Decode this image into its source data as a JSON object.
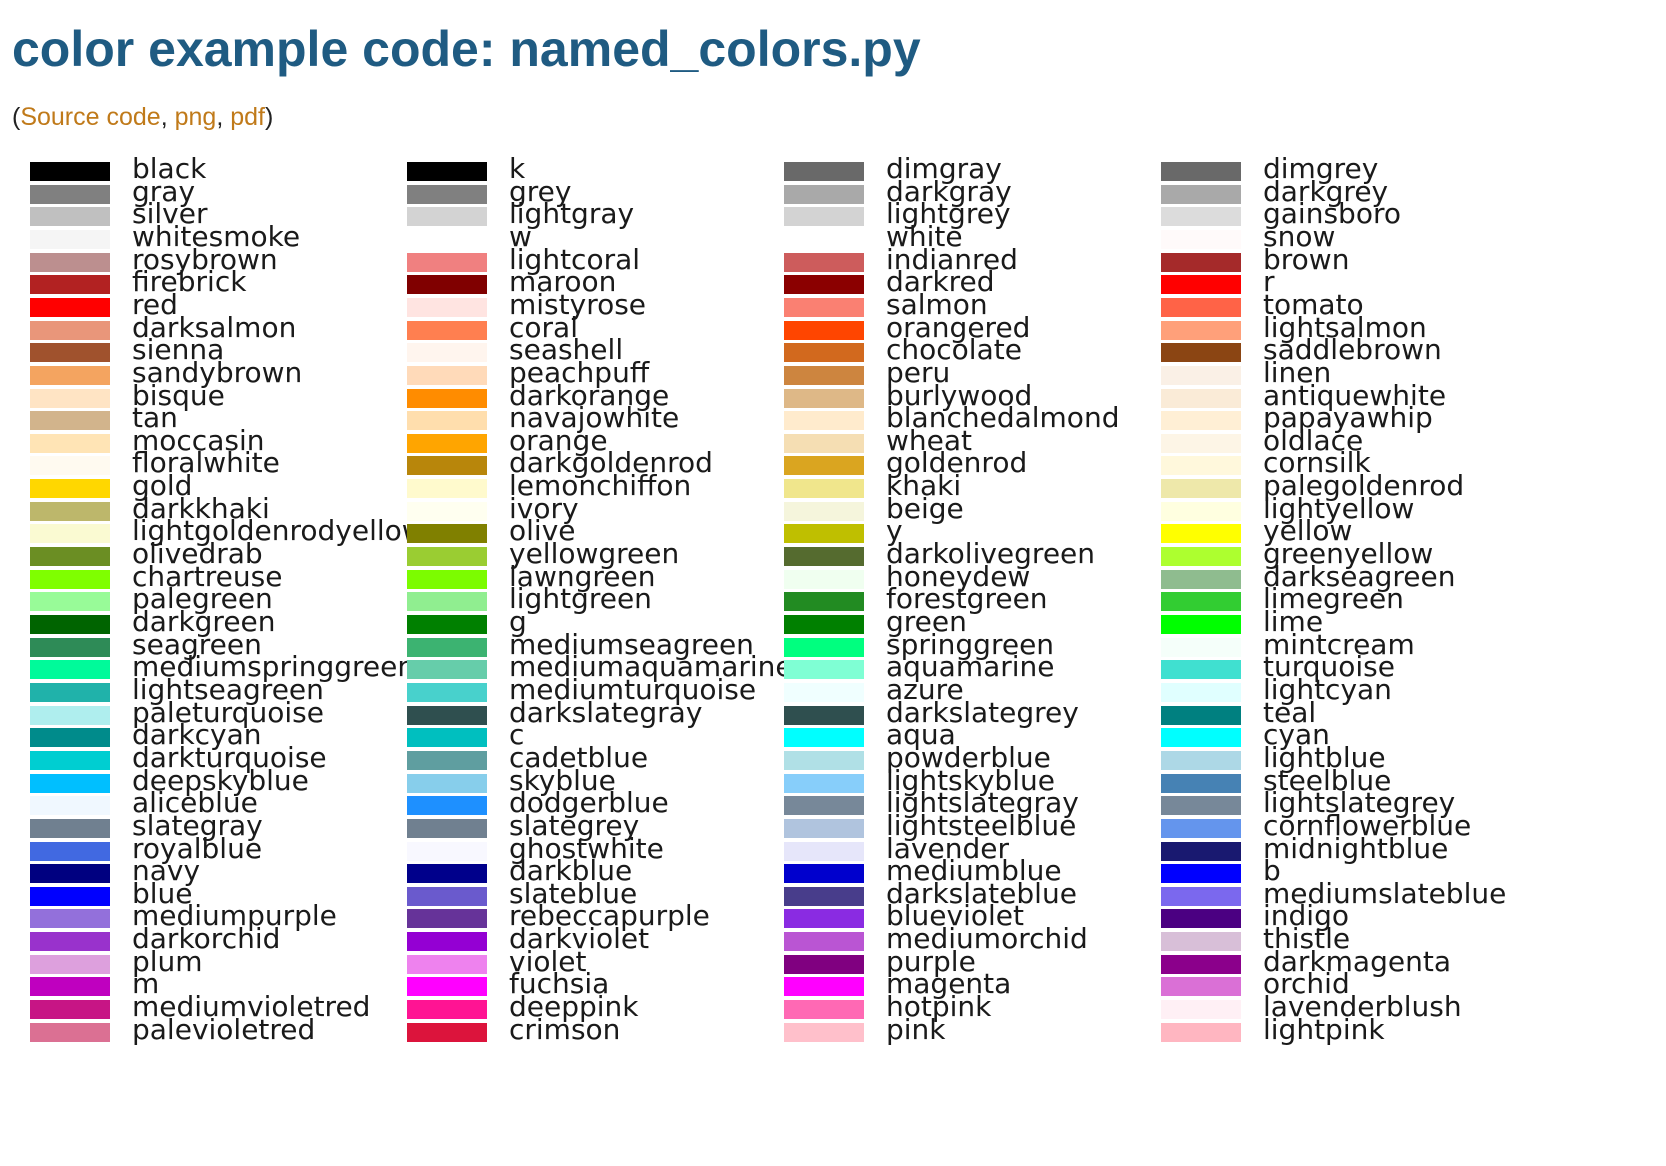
{
  "page": {
    "title": "color example code: named_colors.py",
    "links": {
      "open_paren": "(",
      "source_code": "Source code",
      "sep1": ", ",
      "png": "png",
      "sep2": ", ",
      "pdf": "pdf",
      "close_paren": ")"
    }
  },
  "colors": {
    "columns": [
      [
        {
          "name": "black",
          "hex": "#000000"
        },
        {
          "name": "gray",
          "hex": "#808080"
        },
        {
          "name": "silver",
          "hex": "#c0c0c0"
        },
        {
          "name": "whitesmoke",
          "hex": "#f5f5f5"
        },
        {
          "name": "rosybrown",
          "hex": "#bc8f8f"
        },
        {
          "name": "firebrick",
          "hex": "#b22222"
        },
        {
          "name": "red",
          "hex": "#ff0000"
        },
        {
          "name": "darksalmon",
          "hex": "#e9967a"
        },
        {
          "name": "sienna",
          "hex": "#a0522d"
        },
        {
          "name": "sandybrown",
          "hex": "#f4a460"
        },
        {
          "name": "bisque",
          "hex": "#ffe4c4"
        },
        {
          "name": "tan",
          "hex": "#d2b48c"
        },
        {
          "name": "moccasin",
          "hex": "#ffe4b5"
        },
        {
          "name": "floralwhite",
          "hex": "#fffaf0"
        },
        {
          "name": "gold",
          "hex": "#ffd700"
        },
        {
          "name": "darkkhaki",
          "hex": "#bdb76b"
        },
        {
          "name": "lightgoldenrodyellow",
          "hex": "#fafad2"
        },
        {
          "name": "olivedrab",
          "hex": "#6b8e23"
        },
        {
          "name": "chartreuse",
          "hex": "#7fff00"
        },
        {
          "name": "palegreen",
          "hex": "#98fb98"
        },
        {
          "name": "darkgreen",
          "hex": "#006400"
        },
        {
          "name": "seagreen",
          "hex": "#2e8b57"
        },
        {
          "name": "mediumspringgreen",
          "hex": "#00fa9a"
        },
        {
          "name": "lightseagreen",
          "hex": "#20b2aa"
        },
        {
          "name": "paleturquoise",
          "hex": "#afeeee"
        },
        {
          "name": "darkcyan",
          "hex": "#008b8b"
        },
        {
          "name": "darkturquoise",
          "hex": "#00ced1"
        },
        {
          "name": "deepskyblue",
          "hex": "#00bfff"
        },
        {
          "name": "aliceblue",
          "hex": "#f0f8ff"
        },
        {
          "name": "slategray",
          "hex": "#708090"
        },
        {
          "name": "royalblue",
          "hex": "#4169e1"
        },
        {
          "name": "navy",
          "hex": "#000080"
        },
        {
          "name": "blue",
          "hex": "#0000ff"
        },
        {
          "name": "mediumpurple",
          "hex": "#9370db"
        },
        {
          "name": "darkorchid",
          "hex": "#9932cc"
        },
        {
          "name": "plum",
          "hex": "#dda0dd"
        },
        {
          "name": "m",
          "hex": "#bf00bf"
        },
        {
          "name": "mediumvioletred",
          "hex": "#c71585"
        },
        {
          "name": "palevioletred",
          "hex": "#db7093"
        }
      ],
      [
        {
          "name": "k",
          "hex": "#000000"
        },
        {
          "name": "grey",
          "hex": "#808080"
        },
        {
          "name": "lightgray",
          "hex": "#d3d3d3"
        },
        {
          "name": "w",
          "hex": "#ffffff"
        },
        {
          "name": "lightcoral",
          "hex": "#f08080"
        },
        {
          "name": "maroon",
          "hex": "#800000"
        },
        {
          "name": "mistyrose",
          "hex": "#ffe4e1"
        },
        {
          "name": "coral",
          "hex": "#ff7f50"
        },
        {
          "name": "seashell",
          "hex": "#fff5ee"
        },
        {
          "name": "peachpuff",
          "hex": "#ffdab9"
        },
        {
          "name": "darkorange",
          "hex": "#ff8c00"
        },
        {
          "name": "navajowhite",
          "hex": "#ffdead"
        },
        {
          "name": "orange",
          "hex": "#ffa500"
        },
        {
          "name": "darkgoldenrod",
          "hex": "#b8860b"
        },
        {
          "name": "lemonchiffon",
          "hex": "#fffacd"
        },
        {
          "name": "ivory",
          "hex": "#fffff0"
        },
        {
          "name": "olive",
          "hex": "#808000"
        },
        {
          "name": "yellowgreen",
          "hex": "#9acd32"
        },
        {
          "name": "lawngreen",
          "hex": "#7cfc00"
        },
        {
          "name": "lightgreen",
          "hex": "#90ee90"
        },
        {
          "name": "g",
          "hex": "#008000"
        },
        {
          "name": "mediumseagreen",
          "hex": "#3cb371"
        },
        {
          "name": "mediumaquamarine",
          "hex": "#66cdaa"
        },
        {
          "name": "mediumturquoise",
          "hex": "#48d1cc"
        },
        {
          "name": "darkslategray",
          "hex": "#2f4f4f"
        },
        {
          "name": "c",
          "hex": "#00bfbf"
        },
        {
          "name": "cadetblue",
          "hex": "#5f9ea0"
        },
        {
          "name": "skyblue",
          "hex": "#87ceeb"
        },
        {
          "name": "dodgerblue",
          "hex": "#1e90ff"
        },
        {
          "name": "slategrey",
          "hex": "#708090"
        },
        {
          "name": "ghostwhite",
          "hex": "#f8f8ff"
        },
        {
          "name": "darkblue",
          "hex": "#00008b"
        },
        {
          "name": "slateblue",
          "hex": "#6a5acd"
        },
        {
          "name": "rebeccapurple",
          "hex": "#663399"
        },
        {
          "name": "darkviolet",
          "hex": "#9400d3"
        },
        {
          "name": "violet",
          "hex": "#ee82ee"
        },
        {
          "name": "fuchsia",
          "hex": "#ff00ff"
        },
        {
          "name": "deeppink",
          "hex": "#ff1493"
        },
        {
          "name": "crimson",
          "hex": "#dc143c"
        }
      ],
      [
        {
          "name": "dimgray",
          "hex": "#696969"
        },
        {
          "name": "darkgray",
          "hex": "#a9a9a9"
        },
        {
          "name": "lightgrey",
          "hex": "#d3d3d3"
        },
        {
          "name": "white",
          "hex": "#ffffff"
        },
        {
          "name": "indianred",
          "hex": "#cd5c5c"
        },
        {
          "name": "darkred",
          "hex": "#8b0000"
        },
        {
          "name": "salmon",
          "hex": "#fa8072"
        },
        {
          "name": "orangered",
          "hex": "#ff4500"
        },
        {
          "name": "chocolate",
          "hex": "#d2691e"
        },
        {
          "name": "peru",
          "hex": "#cd853f"
        },
        {
          "name": "burlywood",
          "hex": "#deb887"
        },
        {
          "name": "blanchedalmond",
          "hex": "#ffebcd"
        },
        {
          "name": "wheat",
          "hex": "#f5deb3"
        },
        {
          "name": "goldenrod",
          "hex": "#daa520"
        },
        {
          "name": "khaki",
          "hex": "#f0e68c"
        },
        {
          "name": "beige",
          "hex": "#f5f5dc"
        },
        {
          "name": "y",
          "hex": "#bfbf00"
        },
        {
          "name": "darkolivegreen",
          "hex": "#556b2f"
        },
        {
          "name": "honeydew",
          "hex": "#f0fff0"
        },
        {
          "name": "forestgreen",
          "hex": "#228b22"
        },
        {
          "name": "green",
          "hex": "#008000"
        },
        {
          "name": "springgreen",
          "hex": "#00ff7f"
        },
        {
          "name": "aquamarine",
          "hex": "#7fffd4"
        },
        {
          "name": "azure",
          "hex": "#f0ffff"
        },
        {
          "name": "darkslategrey",
          "hex": "#2f4f4f"
        },
        {
          "name": "aqua",
          "hex": "#00ffff"
        },
        {
          "name": "powderblue",
          "hex": "#b0e0e6"
        },
        {
          "name": "lightskyblue",
          "hex": "#87cefa"
        },
        {
          "name": "lightslategray",
          "hex": "#778899"
        },
        {
          "name": "lightsteelblue",
          "hex": "#b0c4de"
        },
        {
          "name": "lavender",
          "hex": "#e6e6fa"
        },
        {
          "name": "mediumblue",
          "hex": "#0000cd"
        },
        {
          "name": "darkslateblue",
          "hex": "#483d8b"
        },
        {
          "name": "blueviolet",
          "hex": "#8a2be2"
        },
        {
          "name": "mediumorchid",
          "hex": "#ba55d3"
        },
        {
          "name": "purple",
          "hex": "#800080"
        },
        {
          "name": "magenta",
          "hex": "#ff00ff"
        },
        {
          "name": "hotpink",
          "hex": "#ff69b4"
        },
        {
          "name": "pink",
          "hex": "#ffc0cb"
        }
      ],
      [
        {
          "name": "dimgrey",
          "hex": "#696969"
        },
        {
          "name": "darkgrey",
          "hex": "#a9a9a9"
        },
        {
          "name": "gainsboro",
          "hex": "#dcdcdc"
        },
        {
          "name": "snow",
          "hex": "#fffafa"
        },
        {
          "name": "brown",
          "hex": "#a52a2a"
        },
        {
          "name": "r",
          "hex": "#ff0000"
        },
        {
          "name": "tomato",
          "hex": "#ff6347"
        },
        {
          "name": "lightsalmon",
          "hex": "#ffa07a"
        },
        {
          "name": "saddlebrown",
          "hex": "#8b4513"
        },
        {
          "name": "linen",
          "hex": "#faf0e6"
        },
        {
          "name": "antiquewhite",
          "hex": "#faebd7"
        },
        {
          "name": "papayawhip",
          "hex": "#ffefd5"
        },
        {
          "name": "oldlace",
          "hex": "#fdf5e6"
        },
        {
          "name": "cornsilk",
          "hex": "#fff8dc"
        },
        {
          "name": "palegoldenrod",
          "hex": "#eee8aa"
        },
        {
          "name": "lightyellow",
          "hex": "#ffffe0"
        },
        {
          "name": "yellow",
          "hex": "#ffff00"
        },
        {
          "name": "greenyellow",
          "hex": "#adff2f"
        },
        {
          "name": "darkseagreen",
          "hex": "#8fbc8f"
        },
        {
          "name": "limegreen",
          "hex": "#32cd32"
        },
        {
          "name": "lime",
          "hex": "#00ff00"
        },
        {
          "name": "mintcream",
          "hex": "#f5fffa"
        },
        {
          "name": "turquoise",
          "hex": "#40e0d0"
        },
        {
          "name": "lightcyan",
          "hex": "#e0ffff"
        },
        {
          "name": "teal",
          "hex": "#008080"
        },
        {
          "name": "cyan",
          "hex": "#00ffff"
        },
        {
          "name": "lightblue",
          "hex": "#add8e6"
        },
        {
          "name": "steelblue",
          "hex": "#4682b4"
        },
        {
          "name": "lightslategrey",
          "hex": "#778899"
        },
        {
          "name": "cornflowerblue",
          "hex": "#6495ed"
        },
        {
          "name": "midnightblue",
          "hex": "#191970"
        },
        {
          "name": "b",
          "hex": "#0000ff"
        },
        {
          "name": "mediumslateblue",
          "hex": "#7b68ee"
        },
        {
          "name": "indigo",
          "hex": "#4b0082"
        },
        {
          "name": "thistle",
          "hex": "#d8bfd8"
        },
        {
          "name": "darkmagenta",
          "hex": "#8b008b"
        },
        {
          "name": "orchid",
          "hex": "#da70d6"
        },
        {
          "name": "lavenderblush",
          "hex": "#fff0f5"
        },
        {
          "name": "lightpink",
          "hex": "#ffb6c1"
        }
      ]
    ]
  },
  "style": {
    "title_color": "#1f5b82",
    "link_color": "#c07a1a"
  }
}
